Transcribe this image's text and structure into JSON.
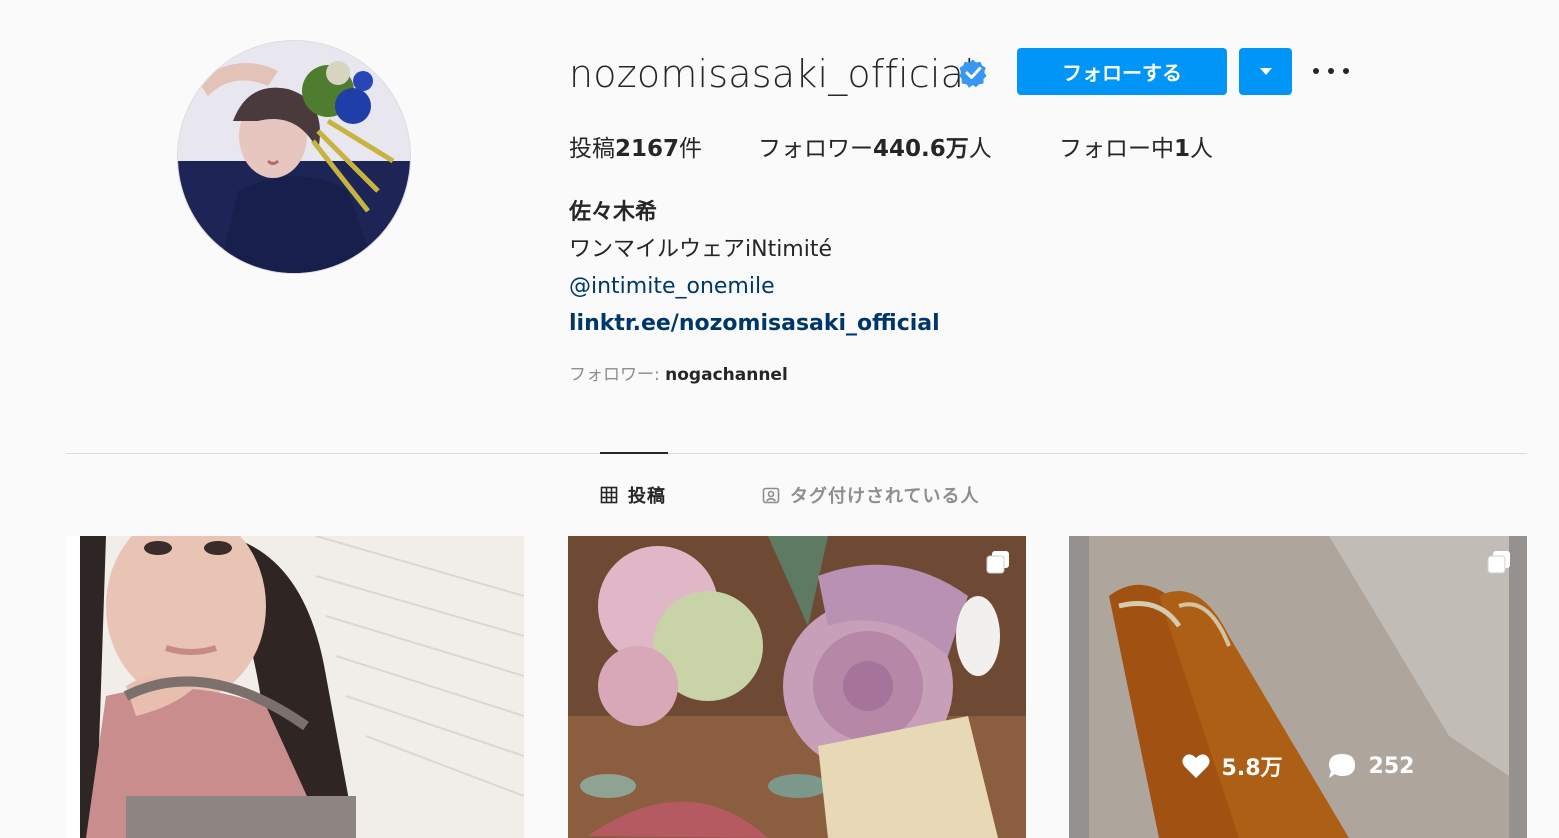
{
  "profile": {
    "username": "nozomisasaki_official",
    "verified": true,
    "follow_label": "フォローする",
    "stats": {
      "posts_label": "投稿",
      "posts_value": "2167",
      "posts_unit": "件",
      "followers_label": "フォロワー",
      "followers_value": "440.6万",
      "followers_unit": "人",
      "following_label": "フォロー中",
      "following_value": "1",
      "following_unit": "人"
    },
    "full_name": "佐々木希",
    "bio_line": "ワンマイルウェアiNtimité",
    "mention": "@intimite_onemile",
    "link": "linktr.ee/nozomisasaki_official",
    "followed_by_label": "フォロワー: ",
    "followed_by_user": "nogachannel"
  },
  "tabs": [
    {
      "label": "投稿",
      "icon": "grid-icon",
      "active": true
    },
    {
      "label": "タグ付けされている人",
      "icon": "tagged-icon",
      "active": false
    }
  ],
  "posts": [
    {
      "description": "selfie",
      "multi": false
    },
    {
      "description": "flowers",
      "multi": true
    },
    {
      "description": "dried-fruit",
      "multi": true,
      "likes": "5.8万",
      "comments": "252"
    }
  ],
  "colors": {
    "accent": "#0095f6",
    "link": "#00376b",
    "background": "#fafafa",
    "muted": "#8e8e8e"
  }
}
